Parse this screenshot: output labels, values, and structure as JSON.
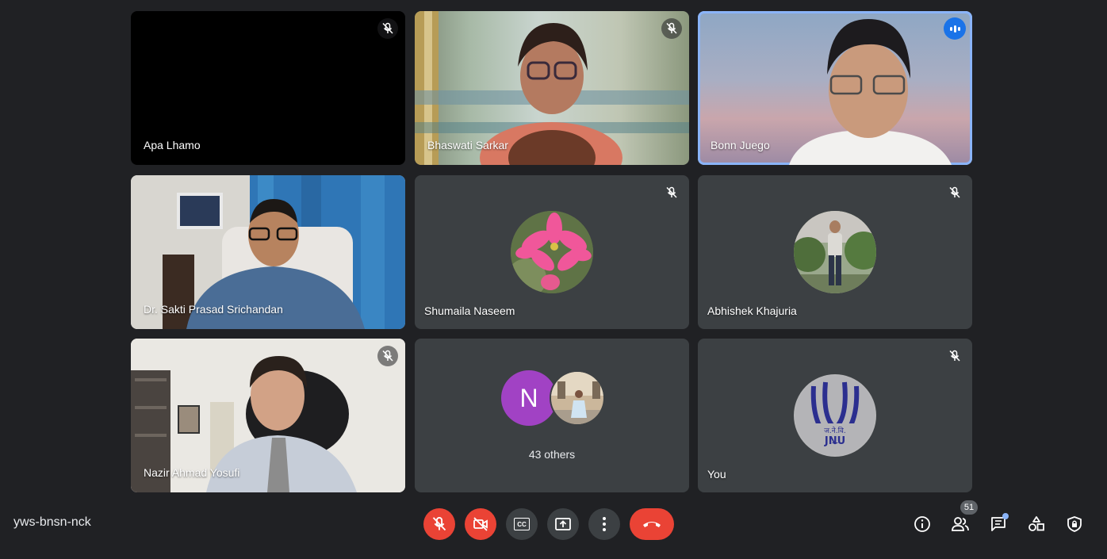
{
  "participants": [
    {
      "name": "Apa Lhamo",
      "muted": true
    },
    {
      "name": "Bhaswati Sarkar",
      "muted": true
    },
    {
      "name": "Bonn Juego",
      "muted": false,
      "speaking": true
    },
    {
      "name": "Dr. Sakti Prasad Srichandan",
      "muted": false
    },
    {
      "name": "Shumaila Naseem",
      "muted": true
    },
    {
      "name": "Abhishek Khajuria",
      "muted": true
    },
    {
      "name": "Nazir Ahmad Yosufi",
      "muted": true
    },
    {
      "name": "43 others",
      "avatar_letter": "N"
    },
    {
      "name": "You",
      "muted": true,
      "logo_text_top": "ज.ने.वि.",
      "logo_text_bottom": "JNU"
    }
  ],
  "meeting": {
    "code": "yws-bnsn-nck"
  },
  "controls": {
    "mic": "mic-off-icon",
    "camera": "camera-off-icon",
    "captions_label": "CC",
    "present": "present-icon",
    "more": "more-vert-icon",
    "end": "end-call-icon"
  },
  "right_controls": {
    "people_count": "51"
  },
  "colors": {
    "background": "#202124",
    "tile": "#3c4043",
    "danger": "#ea4335",
    "active_border": "#8ab4f8",
    "speaking": "#1a73e8",
    "avatar_purple": "#a142c4",
    "jnu_blue": "#2b2f8f"
  }
}
